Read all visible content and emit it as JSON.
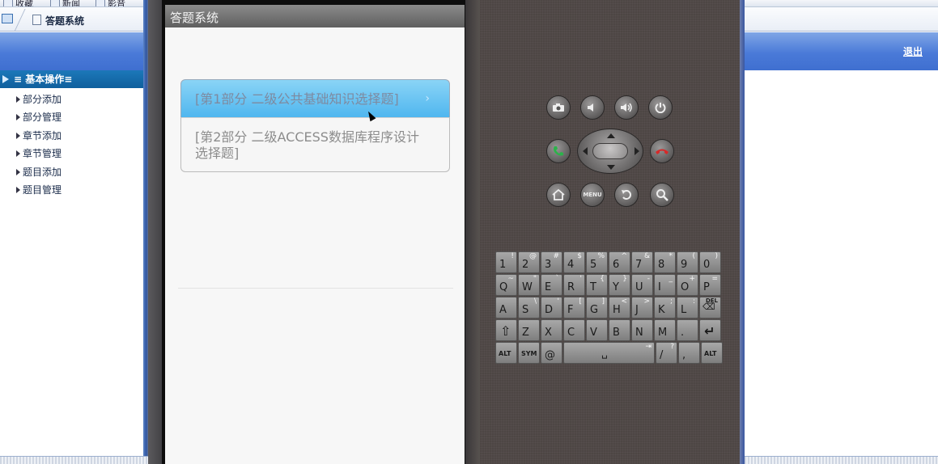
{
  "browser": {
    "toolbar": [
      "收藏",
      "新闻",
      "影音"
    ],
    "tab_title": "答题系统",
    "logout": "退出"
  },
  "sidebar": {
    "header": "≡ 基本操作≡",
    "items": [
      {
        "label": "部分添加"
      },
      {
        "label": "部分管理"
      },
      {
        "label": "章节添加"
      },
      {
        "label": "章节管理"
      },
      {
        "label": "题目添加"
      },
      {
        "label": "题目管理"
      }
    ]
  },
  "device": {
    "app_title": "答题系统",
    "options": [
      {
        "label": "[第1部分  二级公共基础知识选择题]",
        "chevron": "›",
        "selected": true
      },
      {
        "label_line1": "[第2部分  二级ACCESS数据库程序设计",
        "label_line2": "选择题]",
        "selected": false
      }
    ]
  },
  "emulator": {
    "buttons": {
      "camera": "camera-icon",
      "volume_down": "volume-down-icon",
      "volume_up": "volume-up-icon",
      "power": "power-icon",
      "call": "call-icon",
      "end_call": "end-call-icon",
      "home": "home-icon",
      "menu": "MENU",
      "back": "back-icon",
      "search": "search-icon"
    },
    "keyboard": {
      "row1": [
        [
          "1",
          "!"
        ],
        [
          "2",
          "@"
        ],
        [
          "3",
          "#"
        ],
        [
          "4",
          "$"
        ],
        [
          "5",
          "%"
        ],
        [
          "6",
          "^"
        ],
        [
          "7",
          "&"
        ],
        [
          "8",
          "*"
        ],
        [
          "9",
          "("
        ],
        [
          "0",
          ")"
        ]
      ],
      "row2": [
        [
          "Q",
          "~"
        ],
        [
          "W",
          "\""
        ],
        [
          "E",
          "`"
        ],
        [
          "R",
          "'"
        ],
        [
          "T",
          "{"
        ],
        [
          "Y",
          "}"
        ],
        [
          "U",
          "-"
        ],
        [
          "I",
          "_"
        ],
        [
          "O",
          "+"
        ],
        [
          "P",
          "="
        ]
      ],
      "row3": [
        [
          "A",
          ""
        ],
        [
          "S",
          "\\"
        ],
        [
          "D",
          "'"
        ],
        [
          "F",
          "["
        ],
        [
          "G",
          "]"
        ],
        [
          "H",
          "<"
        ],
        [
          "J",
          ">"
        ],
        [
          "K",
          ";"
        ],
        [
          "L",
          ":"
        ]
      ],
      "del": "DEL",
      "row4": [
        [
          "Z",
          ""
        ],
        [
          "X",
          ""
        ],
        [
          "C",
          ""
        ],
        [
          "V",
          ""
        ],
        [
          "B",
          ""
        ],
        [
          "N",
          ""
        ],
        [
          "M",
          ""
        ],
        [
          ".",
          ""
        ]
      ],
      "alt": "ALT",
      "sym": "SYM",
      "at": "@",
      "slash": [
        "/",
        "?"
      ],
      "comma": ","
    }
  }
}
